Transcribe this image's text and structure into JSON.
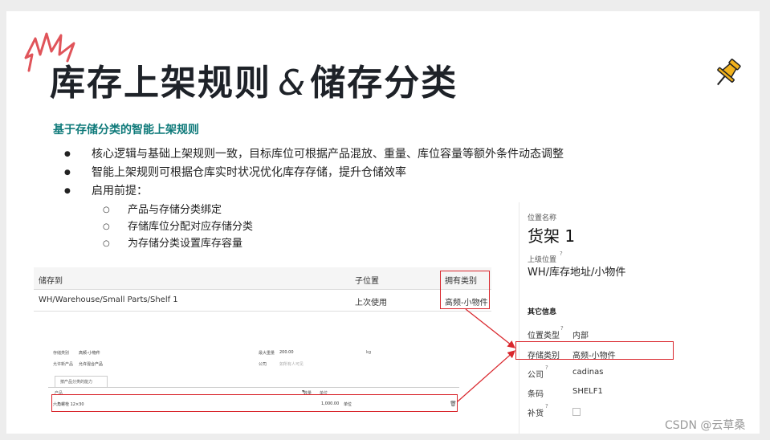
{
  "title": {
    "part1": "库存上架规则",
    "amp": "&",
    "part2": "储存分类"
  },
  "subtitle": "基于存储分类的智能上架规则",
  "bullets": [
    "核心逻辑与基础上架规则一致，目标库位可根据产品混放、重量、库位容量等额外条件动态调整",
    "智能上架规则可根据仓库实时状况优化库存存储，提升仓储效率",
    "启用前提："
  ],
  "sub_bullets": [
    "产品与存储分类绑定",
    "存储库位分配对应存储分类",
    "为存储分类设置库存容量"
  ],
  "table": {
    "headers": {
      "store_to": "储存到",
      "sublocation": "子位置",
      "has_category": "拥有类别"
    },
    "row": {
      "store_to": "WH/Warehouse/Small Parts/Shelf 1",
      "sublocation": "上次使用",
      "has_category": "高频-小物件"
    }
  },
  "form": {
    "storage_category_label": "存储类别",
    "storage_category_value": "高频-小物件",
    "allow_product_label": "允许新产品",
    "allow_product_value": "允许混合产品",
    "max_weight_label": "最大重量",
    "max_weight_value": "200.00",
    "weight_unit": "kg",
    "company_label": "公司",
    "company_placeholder": "如所有人可见",
    "tab_label": "按产品分类的能力",
    "col_product": "产品",
    "col_qty": "数量",
    "col_unit": "单位",
    "row_product": "六角螺栓 12×30",
    "row_qty": "1,000.00",
    "row_unit": "单位"
  },
  "panel": {
    "location_name_label": "位置名称",
    "location_name": "货架 1",
    "parent_label": "上级位置",
    "parent_value": "WH/库存地址/小物件",
    "other_info": "其它信息",
    "location_type_label": "位置类型",
    "location_type_value": "内部",
    "storage_category_label": "存储类别",
    "storage_category_value": "高频-小物件",
    "company_label": "公司",
    "company_value": "cadinas",
    "barcode_label": "条码",
    "barcode_value": "SHELF1",
    "replenish_label": "补货",
    "help_mark": "?"
  },
  "watermark": "CSDN @云草桑",
  "colors": {
    "title": "#1e2228",
    "subtitle": "#0f7a7a",
    "highlight": "#d9262c",
    "burst": "#e0545a",
    "pin": "#f2b21c"
  }
}
